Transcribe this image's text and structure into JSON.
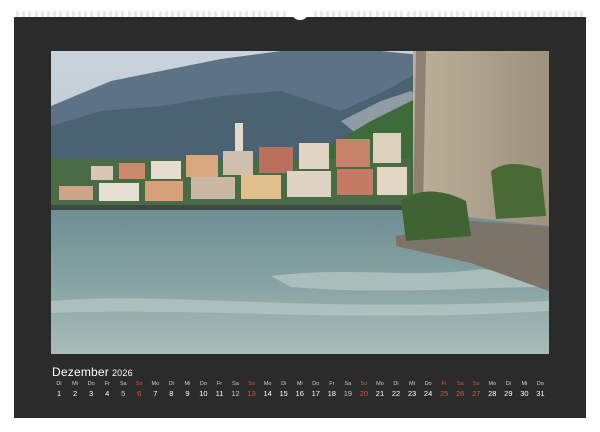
{
  "calendar": {
    "month": "Dezember",
    "year": "2026",
    "colors": {
      "page": "#2b2b2b",
      "weekday": "#ffffff",
      "saturday": "#c9c9c9",
      "sunday": "#e0533f"
    },
    "days": [
      {
        "wd": "Di",
        "num": "1",
        "type": ""
      },
      {
        "wd": "Mi",
        "num": "2",
        "type": ""
      },
      {
        "wd": "Do",
        "num": "3",
        "type": ""
      },
      {
        "wd": "Fr",
        "num": "4",
        "type": ""
      },
      {
        "wd": "Sa",
        "num": "5",
        "type": "sa"
      },
      {
        "wd": "So",
        "num": "6",
        "type": "so"
      },
      {
        "wd": "Mo",
        "num": "7",
        "type": ""
      },
      {
        "wd": "Di",
        "num": "8",
        "type": ""
      },
      {
        "wd": "Mi",
        "num": "9",
        "type": ""
      },
      {
        "wd": "Do",
        "num": "10",
        "type": ""
      },
      {
        "wd": "Fr",
        "num": "11",
        "type": ""
      },
      {
        "wd": "Sa",
        "num": "12",
        "type": "sa"
      },
      {
        "wd": "So",
        "num": "13",
        "type": "so"
      },
      {
        "wd": "Mo",
        "num": "14",
        "type": ""
      },
      {
        "wd": "Di",
        "num": "15",
        "type": ""
      },
      {
        "wd": "Mi",
        "num": "16",
        "type": ""
      },
      {
        "wd": "Do",
        "num": "17",
        "type": ""
      },
      {
        "wd": "Fr",
        "num": "18",
        "type": ""
      },
      {
        "wd": "Sa",
        "num": "19",
        "type": "sa"
      },
      {
        "wd": "So",
        "num": "20",
        "type": "so"
      },
      {
        "wd": "Mo",
        "num": "21",
        "type": ""
      },
      {
        "wd": "Di",
        "num": "22",
        "type": ""
      },
      {
        "wd": "Mi",
        "num": "23",
        "type": ""
      },
      {
        "wd": "Do",
        "num": "24",
        "type": ""
      },
      {
        "wd": "Fr",
        "num": "25",
        "type": "hol"
      },
      {
        "wd": "Sa",
        "num": "26",
        "type": "hol"
      },
      {
        "wd": "So",
        "num": "27",
        "type": "so"
      },
      {
        "wd": "Mo",
        "num": "28",
        "type": ""
      },
      {
        "wd": "Di",
        "num": "29",
        "type": ""
      },
      {
        "wd": "Mi",
        "num": "30",
        "type": ""
      },
      {
        "wd": "Do",
        "num": "31",
        "type": ""
      }
    ]
  },
  "photo": {
    "subject": "lakeside-town-photo"
  }
}
